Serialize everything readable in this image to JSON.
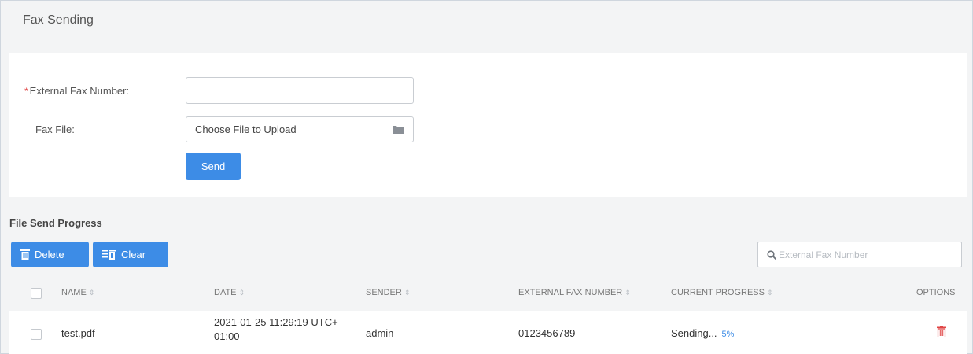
{
  "page": {
    "title": "Fax Sending"
  },
  "form": {
    "fax_number_label": "External Fax Number:",
    "required_mark": "*",
    "fax_number_value": "",
    "fax_file_label": "Fax File:",
    "fax_file_placeholder": "Choose File to Upload",
    "send_label": "Send"
  },
  "progress": {
    "title": "File Send Progress",
    "delete_label": "Delete",
    "clear_label": "Clear",
    "search_placeholder": "External Fax Number"
  },
  "table": {
    "columns": [
      "NAME",
      "DATE",
      "SENDER",
      "EXTERNAL FAX NUMBER",
      "CURRENT PROGRESS",
      "OPTIONS"
    ],
    "rows": [
      {
        "name": "test.pdf",
        "date_line1": "2021-01-25 11:29:19 UTC+",
        "date_line2": "01:00",
        "sender": "admin",
        "fax_number": "0123456789",
        "status": "Sending...",
        "percent": "5%"
      }
    ]
  },
  "colors": {
    "accent": "#3d8ce6",
    "danger": "#e04545"
  },
  "icons": [
    "folder-icon",
    "trash-icon",
    "clear-list-icon",
    "search-icon",
    "delete-row-icon"
  ]
}
